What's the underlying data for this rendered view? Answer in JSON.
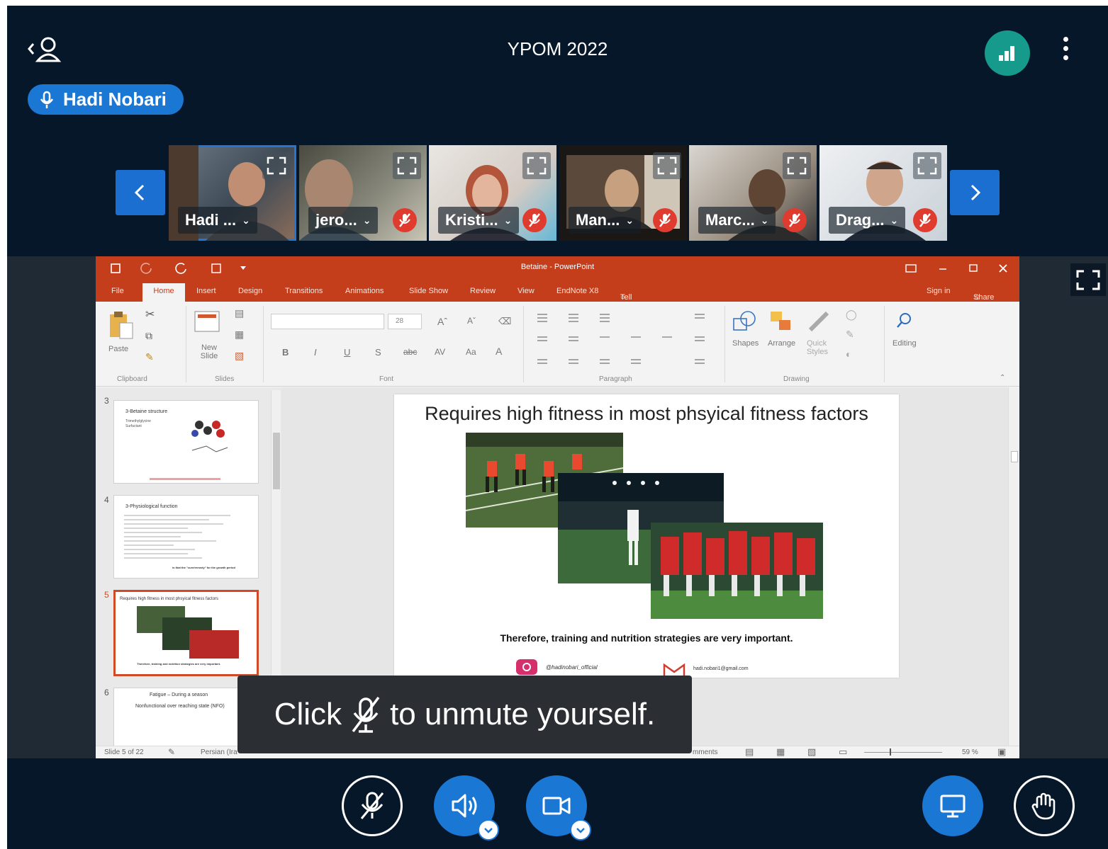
{
  "meeting": {
    "title": "YPOM 2022"
  },
  "talking_indicator": {
    "name": "Hadi Nobari"
  },
  "participants": [
    {
      "label": "Hadi ...",
      "muted": false,
      "active": true
    },
    {
      "label": "jero...",
      "muted": true,
      "active": false
    },
    {
      "label": "Kristi...",
      "muted": true,
      "active": false
    },
    {
      "label": "Man...",
      "muted": true,
      "active": false
    },
    {
      "label": "Marc...",
      "muted": true,
      "active": false
    },
    {
      "label": "Drag...",
      "muted": true,
      "active": false
    }
  ],
  "powerpoint": {
    "window_title": "Betaine - PowerPoint",
    "tabs": [
      "File",
      "Home",
      "Insert",
      "Design",
      "Transitions",
      "Animations",
      "Slide Show",
      "Review",
      "View",
      "EndNote X8"
    ],
    "tell_me": "Tell me what you want to do...",
    "sign_in": "Sign in",
    "share": "Share",
    "ribbon": {
      "clipboard": "Clipboard",
      "paste": "Paste",
      "slides": "Slides",
      "new_slide": "New Slide",
      "font": "Font",
      "font_size": "28",
      "paragraph": "Paragraph",
      "drawing": "Drawing",
      "shapes": "Shapes",
      "arrange": "Arrange",
      "quick_styles": "Quick Styles",
      "editing": "Editing"
    },
    "thumbnails": [
      {
        "num": "3",
        "title": "3-Betaine structure",
        "bullets": [
          "Trimethylglycine",
          "Surfactant"
        ]
      },
      {
        "num": "4",
        "title": "3-Physiological function",
        "footer": "is that the \"cure/remedy\" for the growth period"
      },
      {
        "num": "5",
        "title": "Requires high fitness in most phsyical fitness factors",
        "footer": "Therefore, training and nutrition strategies are very important."
      },
      {
        "num": "6",
        "title": "Fatigue – During a season",
        "subtitle": "Nonfunctional over reaching state (NFO)"
      }
    ],
    "slide": {
      "heading": "Requires high fitness in most phsyical fitness factors",
      "caption": "Therefore, training and nutrition strategies are very important.",
      "instagram": "@hadinobari_official",
      "email": "hadi.nobari1@gmail.com"
    },
    "status": {
      "slide_count": "Slide 5 of 22",
      "language": "Persian (Ira",
      "comments": "mments",
      "zoom": "59 %"
    }
  },
  "toast": {
    "before": "Click",
    "after": "to unmute yourself."
  },
  "controls": {
    "mic": "muted",
    "audio": "on",
    "camera": "on",
    "screen_share": "presenting",
    "raise_hand": "off"
  },
  "colors": {
    "background": "#06172a",
    "accent_blue": "#1b77d4",
    "stats_teal": "#159a8c",
    "muted_red": "#e03b2f",
    "ppt_orange": "#c43e1c"
  }
}
